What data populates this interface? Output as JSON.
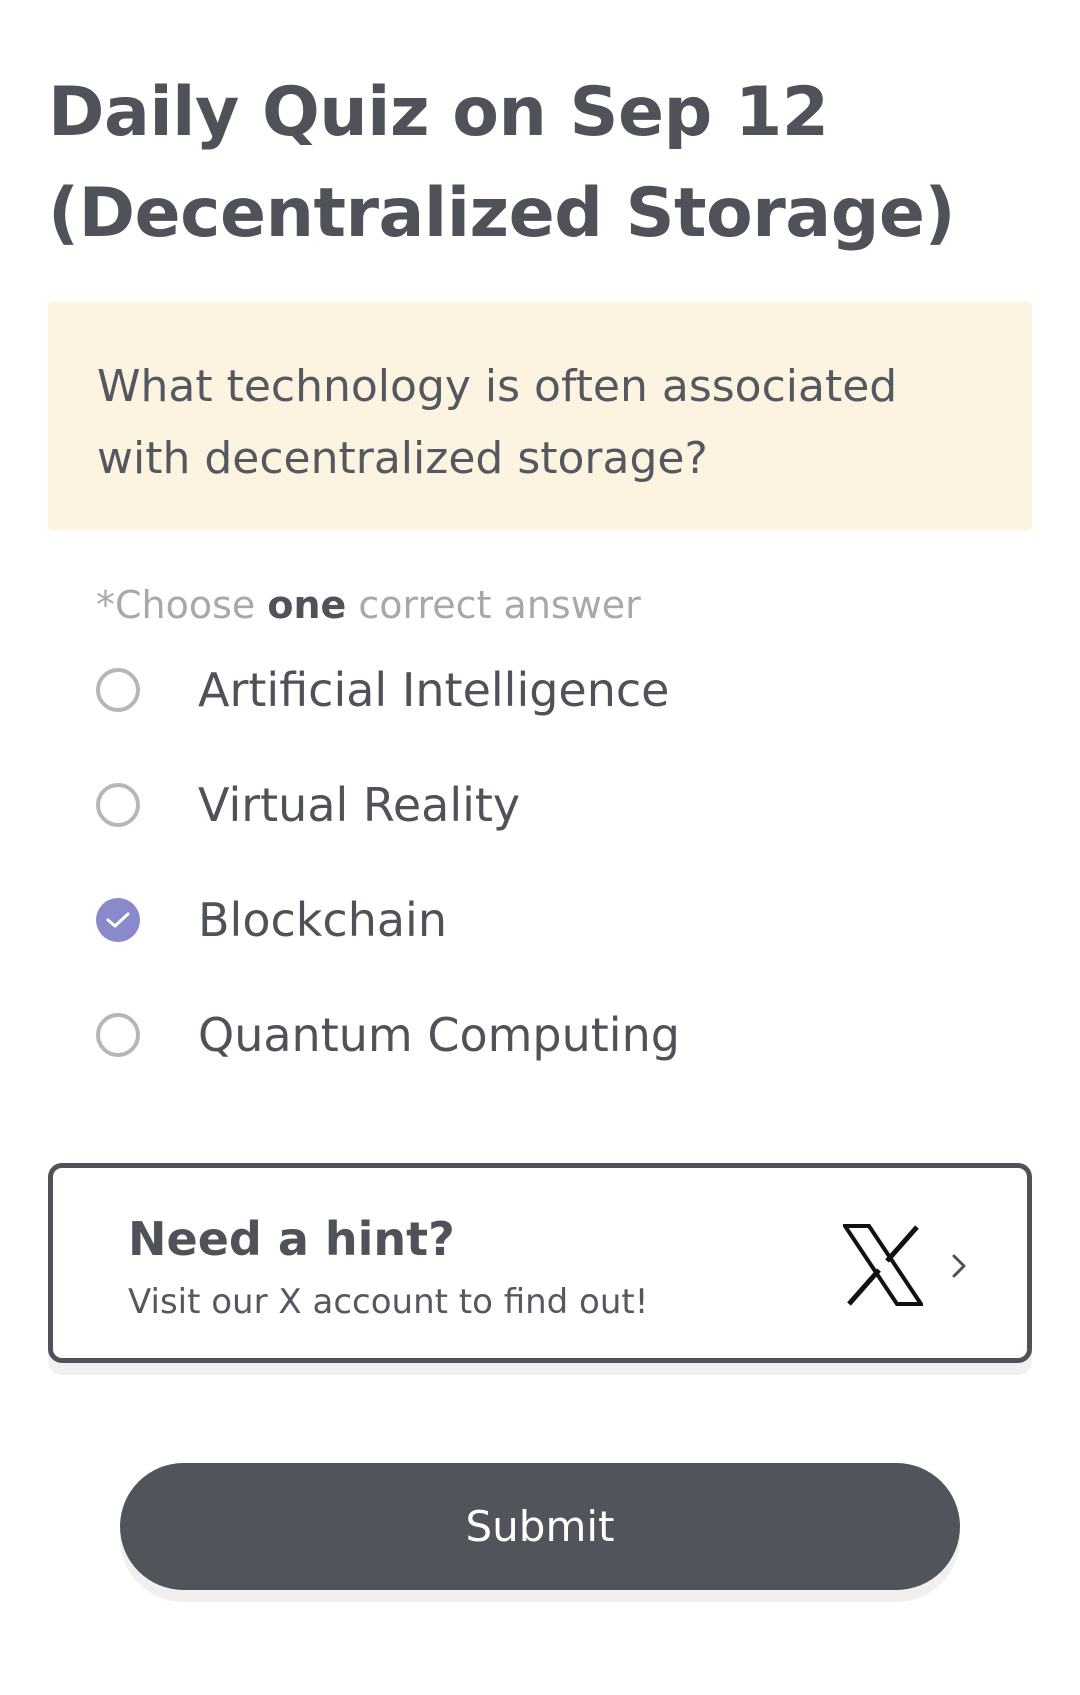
{
  "quiz": {
    "title": "Daily Quiz on Sep 12 (Decentralized Storage)",
    "question": "What technology is often associated with decentralized storage?",
    "instruction": {
      "prefix": "*Choose ",
      "emphasis": "one",
      "suffix": " correct answer"
    },
    "options": [
      {
        "label": "Artificial Intelligence",
        "selected": false
      },
      {
        "label": "Virtual Reality",
        "selected": false
      },
      {
        "label": "Blockchain",
        "selected": true
      },
      {
        "label": "Quantum Computing",
        "selected": false
      }
    ]
  },
  "hint": {
    "title": "Need a hint?",
    "subtitle": "Visit our X account to find out!",
    "icon": "x-logo-icon",
    "chevron_icon": "chevron-right-icon"
  },
  "submit": {
    "label": "Submit"
  },
  "colors": {
    "text": "#4f5259",
    "question_bg": "#fdf3e1",
    "radio_selected": "#8a89cc",
    "radio_unselected": "#b5b6ba",
    "submit_bg": "#52545c",
    "instruction": "#a7a8ad"
  }
}
